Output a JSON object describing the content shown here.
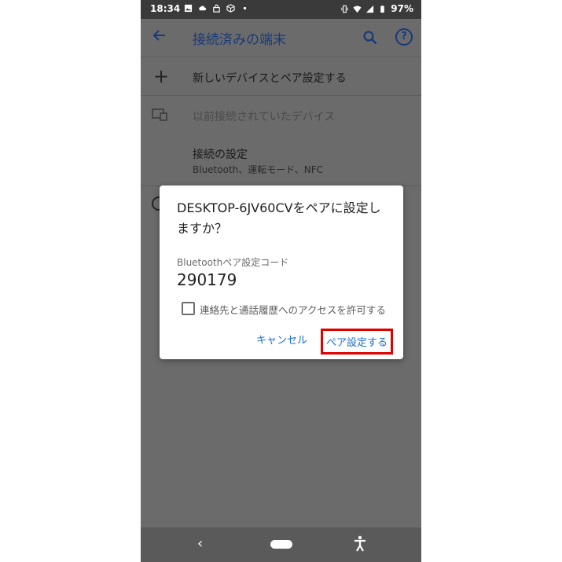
{
  "status_bar": {
    "time": "18:34",
    "battery": "97%"
  },
  "app_bar": {
    "title": "接続済みの端末"
  },
  "list": {
    "pair_new": "新しいデバイスとペア設定する",
    "previously_connected": "以前接続されていたデバイス",
    "connection_prefs_title": "接続の設定",
    "connection_prefs_subtitle": "Bluetooth、運転モード、NFC"
  },
  "dialog": {
    "title": "DESKTOP-6JV60CVをペアに設定しますか？",
    "code_label": "Bluetoothペア設定コード",
    "code": "290179",
    "checkbox_label": "連絡先と通話履歴へのアクセスを許可する",
    "cancel": "キャンセル",
    "confirm": "ペア設定する"
  },
  "icons": [
    "image-icon",
    "cloud-icon",
    "lock-icon",
    "package-icon",
    "dot-icon",
    "vibrate-icon",
    "wifi-icon",
    "signal-icon",
    "battery-icon",
    "back-arrow-icon",
    "search-icon",
    "help-icon",
    "plus-icon",
    "devices-icon",
    "nav-back-icon",
    "home-pill-icon",
    "accessibility-icon"
  ],
  "colors": {
    "accent": "#1a6fd0",
    "highlight_box": "#e00000"
  }
}
